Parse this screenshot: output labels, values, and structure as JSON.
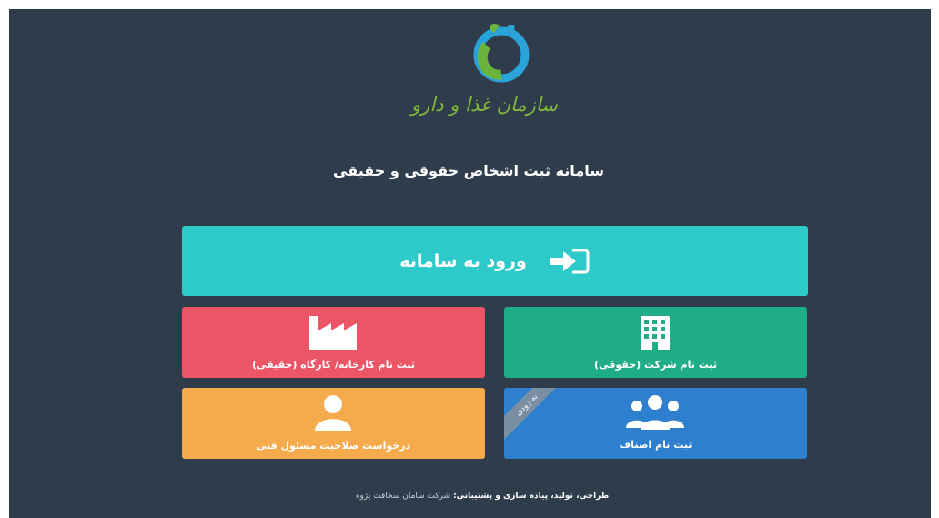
{
  "logo": {
    "text": "سازمان غذا و دارو"
  },
  "page_title": "سامانه ثبت اشخاص حقوقی و حقیقی",
  "login": {
    "label": "ورود به سامانه",
    "icon": "sign-in-icon"
  },
  "tiles": {
    "legal": {
      "label": "ثبت نام شرکت (حقوقی)",
      "icon": "building-icon",
      "color": "#1fac87"
    },
    "workshop": {
      "label": "ثبت نام کارخانه/ کارگاه (حقیقی)",
      "icon": "factory-icon",
      "color": "#ec5566"
    },
    "guild": {
      "label": "ثبت نام اصناف",
      "icon": "users-icon",
      "color": "#2e7fce",
      "ribbon": "به زودی"
    },
    "tech": {
      "label": "درخواست صلاحیت مسئول فنی",
      "icon": "user-icon",
      "color": "#f5aa4c"
    }
  },
  "footer": {
    "label": "طراحی، تولید، پیاده سازی و پشتیبانی:",
    "company": "شرکت سامان سخافت پژوه"
  }
}
